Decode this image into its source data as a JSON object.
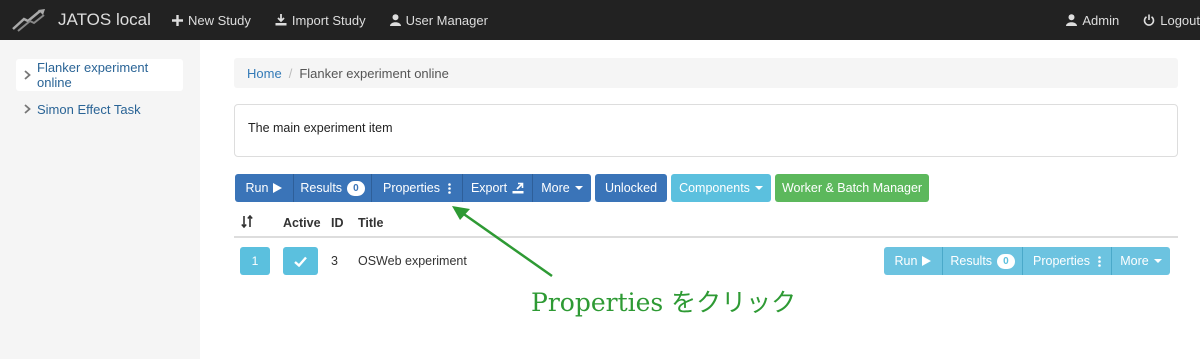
{
  "navbar": {
    "brand": "JATOS local",
    "items": [
      {
        "label": "New Study",
        "icon": "plus-icon"
      },
      {
        "label": "Import Study",
        "icon": "import-icon"
      },
      {
        "label": "User Manager",
        "icon": "user-icon"
      }
    ],
    "right": [
      {
        "label": "Admin",
        "icon": "user-icon"
      },
      {
        "label": "Logout",
        "icon": "power-icon"
      }
    ]
  },
  "sidebar": {
    "items": [
      {
        "label": "Flanker experiment online",
        "active": true
      },
      {
        "label": "Simon Effect Task",
        "active": false
      }
    ]
  },
  "breadcrumb": {
    "home": "Home",
    "separator": "/",
    "current": "Flanker experiment online"
  },
  "description": "The main experiment item",
  "toolbar": {
    "run": "Run",
    "results": "Results",
    "results_count": "0",
    "properties": "Properties",
    "export": "Export",
    "more": "More",
    "unlocked": "Unlocked",
    "components": "Components",
    "worker_batch": "Worker & Batch Manager"
  },
  "table": {
    "headers": {
      "active": "Active",
      "id": "ID",
      "title": "Title"
    },
    "rows": [
      {
        "position": "1",
        "id": "3",
        "title": "OSWeb experiment",
        "run": "Run",
        "results": "Results",
        "results_count": "0",
        "properties": "Properties",
        "more": "More"
      }
    ]
  },
  "annotation": {
    "text": "Properties をクリック",
    "color": "#2e9a34"
  },
  "colors": {
    "navbar": "#222222",
    "primary": "#3a74b8",
    "info": "#5bc0de",
    "success": "#5cb85c",
    "link": "#337ab7"
  }
}
